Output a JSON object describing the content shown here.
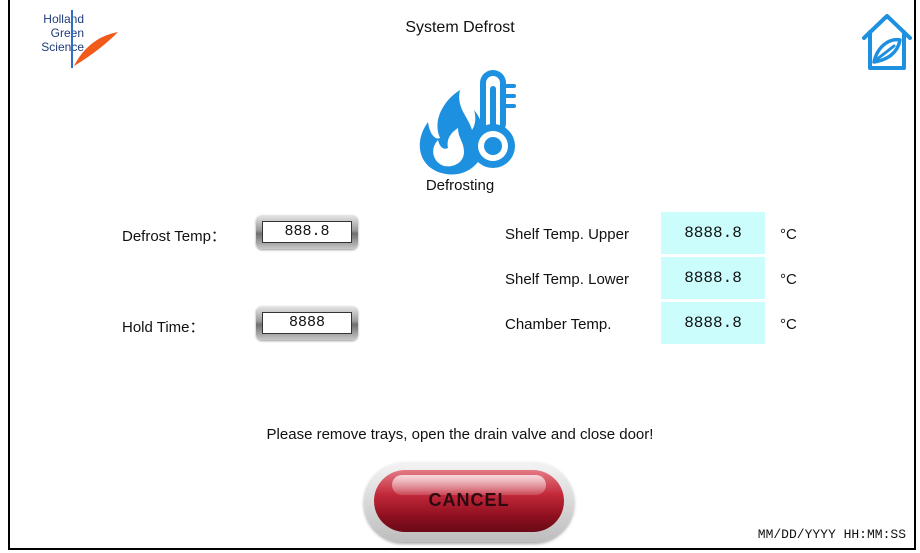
{
  "header": {
    "title": "System Defrost",
    "logo_lines": [
      "Holland",
      "Green",
      "Science"
    ],
    "home_icon": "home-leaf-icon"
  },
  "status": {
    "icon": "fire-thermometer-icon",
    "label": "Defrosting"
  },
  "settings": {
    "defrost_temp_label": "Defrost Temp：",
    "defrost_temp_value": "888.8",
    "hold_time_label": "Hold Time：",
    "hold_time_value": "8888"
  },
  "readings": [
    {
      "label": "Shelf Temp. Upper",
      "value": "8888.8",
      "unit": "°C"
    },
    {
      "label": "Shelf Temp. Lower",
      "value": "8888.8",
      "unit": "°C"
    },
    {
      "label": "Chamber Temp.",
      "value": "8888.8",
      "unit": "°C"
    }
  ],
  "message": "Please remove trays, open the drain valve and close door!",
  "cancel_label": "CANCEL",
  "datetime": "MM/DD/YYYY HH:MM:SS",
  "colors": {
    "accent_blue": "#1e90e0",
    "readout_bg": "#ccfdfd",
    "cancel_red": "#a8182a",
    "logo_orange": "#f05a1a"
  }
}
